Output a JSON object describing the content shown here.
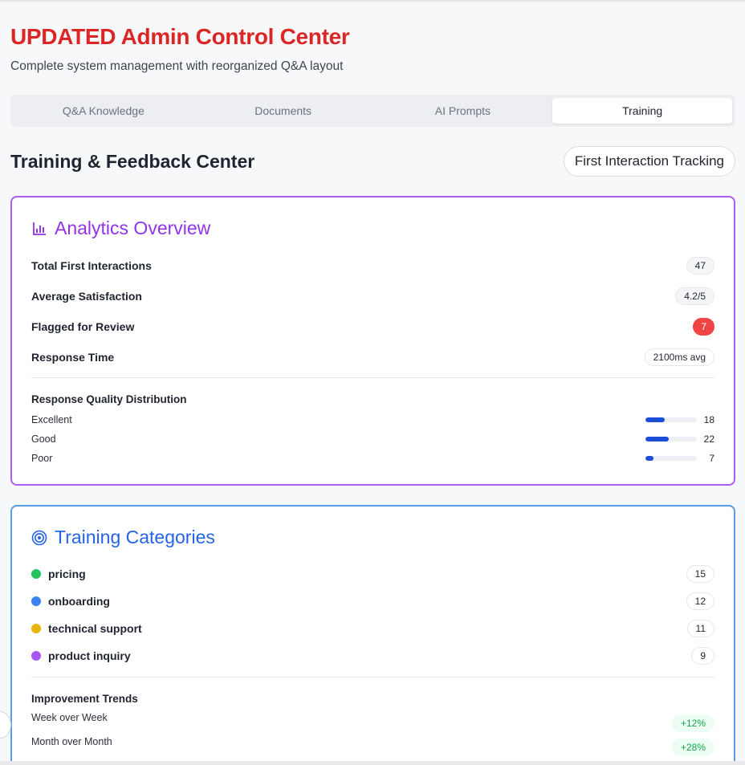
{
  "header": {
    "title": "UPDATED Admin Control Center",
    "subtitle": "Complete system management with reorganized Q&A layout"
  },
  "tabs": [
    {
      "label": "Q&A Knowledge",
      "active": false
    },
    {
      "label": "Documents",
      "active": false
    },
    {
      "label": "AI Prompts",
      "active": false
    },
    {
      "label": "Training",
      "active": true
    }
  ],
  "section": {
    "title": "Training & Feedback Center",
    "action_label": "First Interaction Tracking"
  },
  "analytics": {
    "title": "Analytics Overview",
    "icon": "bar-chart-icon",
    "stats": [
      {
        "label": "Total First Interactions",
        "value": "47"
      },
      {
        "label": "Average Satisfaction",
        "value": "4.2/5"
      },
      {
        "label": "Flagged for Review",
        "value": "7"
      },
      {
        "label": "Response Time",
        "value": "2100ms avg"
      }
    ],
    "distribution_title": "Response Quality Distribution",
    "distribution": [
      {
        "label": "Excellent",
        "count": "18",
        "fill": 0.38
      },
      {
        "label": "Good",
        "count": "22",
        "fill": 0.46
      },
      {
        "label": "Poor",
        "count": "7",
        "fill": 0.15
      }
    ]
  },
  "categories": {
    "title": "Training Categories",
    "icon": "target-icon",
    "items": [
      {
        "label": "pricing",
        "count": "15",
        "color": "#22c55e"
      },
      {
        "label": "onboarding",
        "count": "12",
        "color": "#3b82f6"
      },
      {
        "label": "technical support",
        "count": "11",
        "color": "#eab308"
      },
      {
        "label": "product inquiry",
        "count": "9",
        "color": "#a855f7"
      }
    ],
    "trends_title": "Improvement Trends",
    "trends": [
      {
        "label": "Week over Week",
        "value": "+12%"
      },
      {
        "label": "Month over Month",
        "value": "+28%"
      }
    ]
  },
  "colors": {
    "title_red": "#dc2626",
    "analytics_purple": "#9333ea",
    "categories_blue": "#2563eb",
    "bar_blue": "#1d4ed8",
    "flag_red": "#ef4444",
    "trend_green": "#16a34a"
  }
}
